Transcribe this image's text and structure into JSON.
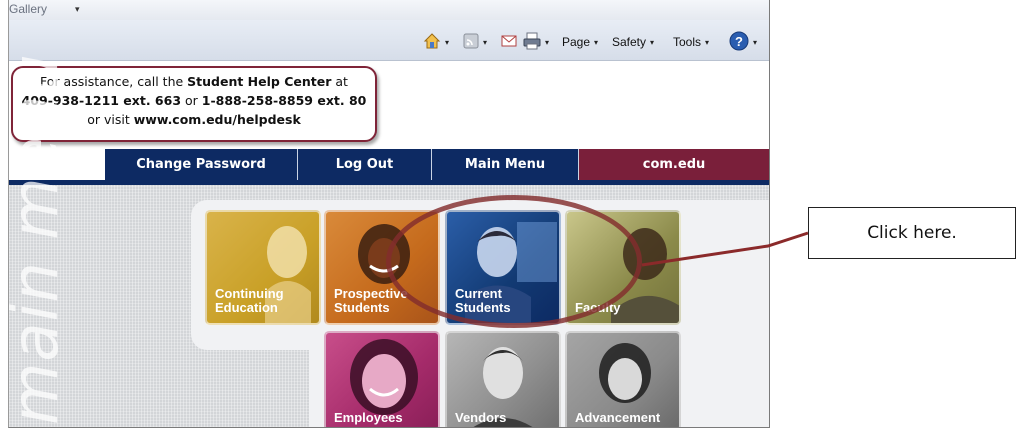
{
  "browser": {
    "gallery_label": "e Gallery",
    "gallery_caret": "▾",
    "toolbar": {
      "home_icon": "home-icon",
      "feeds_icon": "feeds-icon",
      "mail_icon": "mail-icon",
      "print_icon": "print-icon",
      "page_label": "Page",
      "safety_label": "Safety",
      "tools_label": "Tools",
      "help_icon": "help-icon",
      "dropdown_glyph": "▾"
    }
  },
  "help_box": {
    "line1_pre": "For assistance, call the ",
    "line1_bold": "Student Help Center",
    "line1_post": " at",
    "line2_bold1": "409-938-1211 ext. 663",
    "line2_mid": " or ",
    "line2_bold2": "1-888-258-8859 ext. 80",
    "line3_pre": "or visit ",
    "line3_bold": "www.com.edu/helpdesk"
  },
  "nav": {
    "items": [
      {
        "label": "Change Password"
      },
      {
        "label": "Log Out"
      },
      {
        "label": "Main Menu"
      },
      {
        "label": "com.edu"
      }
    ]
  },
  "menu": {
    "watermark": "main menu",
    "tiles": [
      {
        "line1": "Continuing",
        "line2": "Education"
      },
      {
        "line1": "Prospective",
        "line2": "Students"
      },
      {
        "line1": "Current",
        "line2": "Students"
      },
      {
        "line1": "Faculty",
        "line2": ""
      },
      {
        "line1": "Employees",
        "line2": ""
      },
      {
        "line1": "Vendors",
        "line2": ""
      },
      {
        "line1": "Advancement",
        "line2": ""
      }
    ]
  },
  "annotation": {
    "callout_text": "Click here.",
    "color": "#8b2a2a"
  },
  "colors": {
    "nav_blue": "#0d2a63",
    "nav_maroon": "#7a1f3a",
    "tile_gold": "#c9a027",
    "tile_orange": "#c56a1c",
    "tile_navy": "#123a73",
    "tile_olive": "#8b8a4a",
    "tile_magenta": "#a52b6a",
    "tile_gray": "#8e8e8e"
  }
}
